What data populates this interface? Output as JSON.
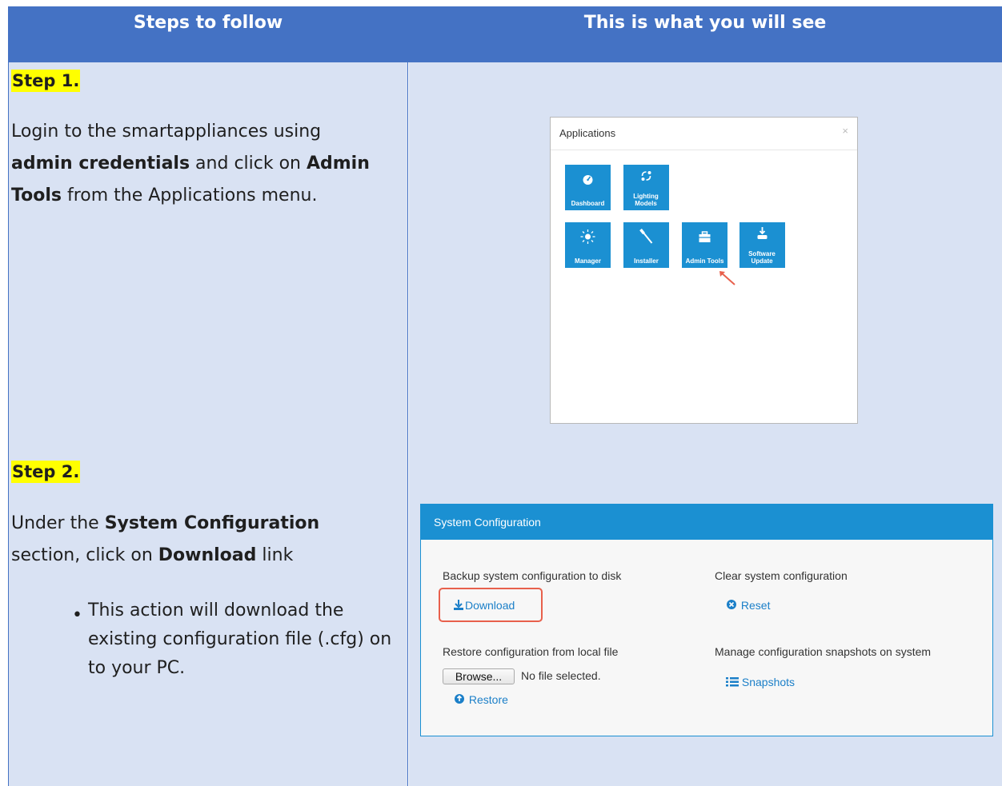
{
  "header": {
    "left": "Steps to follow",
    "right": "This is what you will see"
  },
  "step1": {
    "label": "Step 1.",
    "text_1": "Login to the smartappliances using",
    "bold_1": "admin credentials",
    "text_2": " and click on ",
    "bold_2": "Admin",
    "bold_3": "Tools",
    "text_3": " from the Applications menu."
  },
  "step2": {
    "label": "Step 2.",
    "text_1": "Under the ",
    "bold_1": "System Configuration",
    "text_2": "section, click on ",
    "bold_2": "Download",
    "text_3": " link",
    "bullet": "This action will download the existing configuration file (.cfg) on to your PC."
  },
  "applications": {
    "title": "Applications",
    "close": "×",
    "tiles": [
      {
        "label": "Dashboard",
        "icon": "gauge-icon"
      },
      {
        "label": "Lighting Models",
        "icon": "lighting-models-icon"
      },
      {
        "label": "Manager",
        "icon": "sun-icon"
      },
      {
        "label": "Installer",
        "icon": "screwdriver-icon"
      },
      {
        "label": "Admin Tools",
        "icon": "toolbox-icon"
      },
      {
        "label": "Software Update",
        "icon": "software-update-icon"
      }
    ]
  },
  "system_config": {
    "title": "System Configuration",
    "backup_label": "Backup system configuration to disk",
    "download": "Download",
    "clear_label": "Clear system configuration",
    "reset": "Reset",
    "restore_label": "Restore configuration from local file",
    "browse": "Browse...",
    "no_file": "No file selected.",
    "restore": "Restore",
    "snapshots_label": "Manage configuration snapshots on system",
    "snapshots": "Snapshots"
  },
  "colors": {
    "header_bg": "#4472c4",
    "cell_bg": "#d9e2f3",
    "tile_bg": "#1b90d2",
    "highlight": "#ffff00",
    "callout": "#e8604c"
  }
}
